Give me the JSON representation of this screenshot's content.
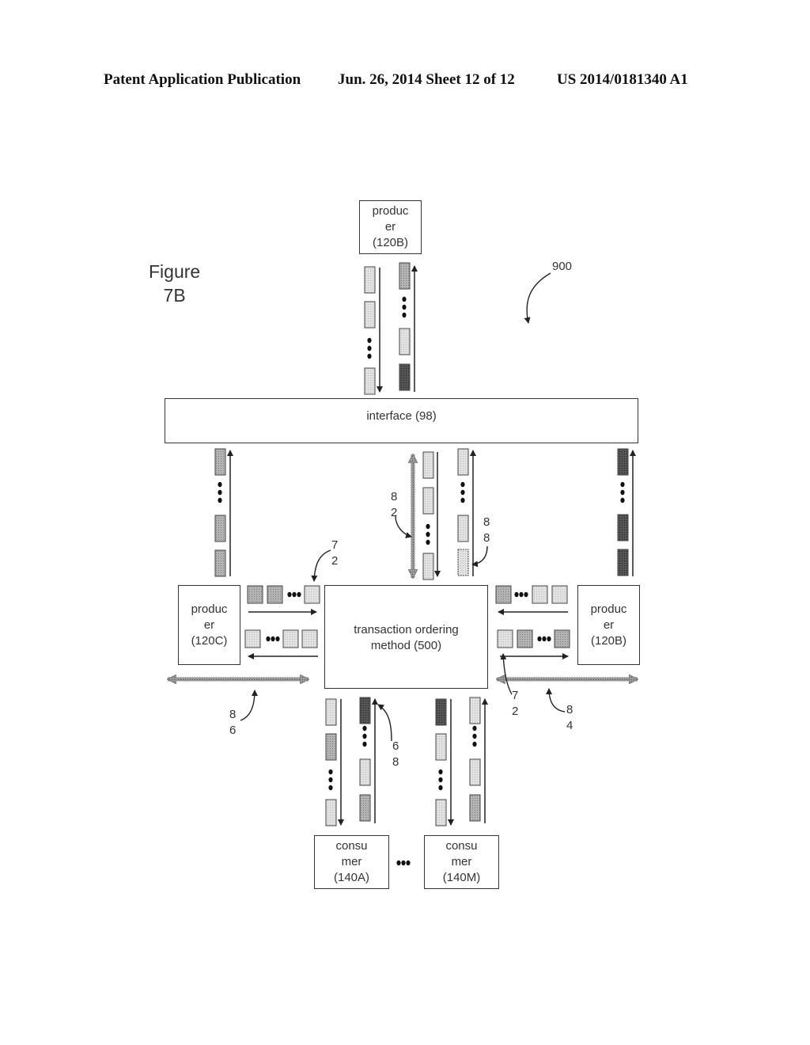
{
  "header": {
    "left": "Patent Application Publication",
    "center": "Jun. 26, 2014  Sheet 12 of 12",
    "right": "US 2014/0181340 A1"
  },
  "figure": {
    "line1": "Figure",
    "line2": "7B"
  },
  "reference": "900",
  "nodes": {
    "producer_top": {
      "l1": "produc",
      "l2": "er",
      "l3": "(120B)"
    },
    "interface": {
      "label": "interface (98)"
    },
    "producer_left": {
      "l1": "produc",
      "l2": "er",
      "l3": "(120C)"
    },
    "producer_right": {
      "l1": "produc",
      "l2": "er",
      "l3": "(120B)"
    },
    "method": {
      "l1": "transaction ordering",
      "l2": "method (500)"
    },
    "consumer_a": {
      "l1": "consu",
      "l2": "mer",
      "l3": "(140A)"
    },
    "consumer_m": {
      "l1": "consu",
      "l2": "mer",
      "l3": "(140M)"
    }
  },
  "callouts": {
    "c82": {
      "a": "8",
      "b": "2"
    },
    "c88": {
      "a": "8",
      "b": "8"
    },
    "c72_left": {
      "a": "7",
      "b": "2"
    },
    "c72_right": {
      "a": "7",
      "b": "2"
    },
    "c86": {
      "a": "8",
      "b": "6"
    },
    "c84": {
      "a": "8",
      "b": "4"
    },
    "c68": {
      "a": "6",
      "b": "8"
    }
  },
  "colors": {
    "light": "#d8d8d8",
    "medium": "#a8a8a8",
    "dark": "#4a4a4a",
    "line": "#222222",
    "bus": "#8a8a8a"
  }
}
